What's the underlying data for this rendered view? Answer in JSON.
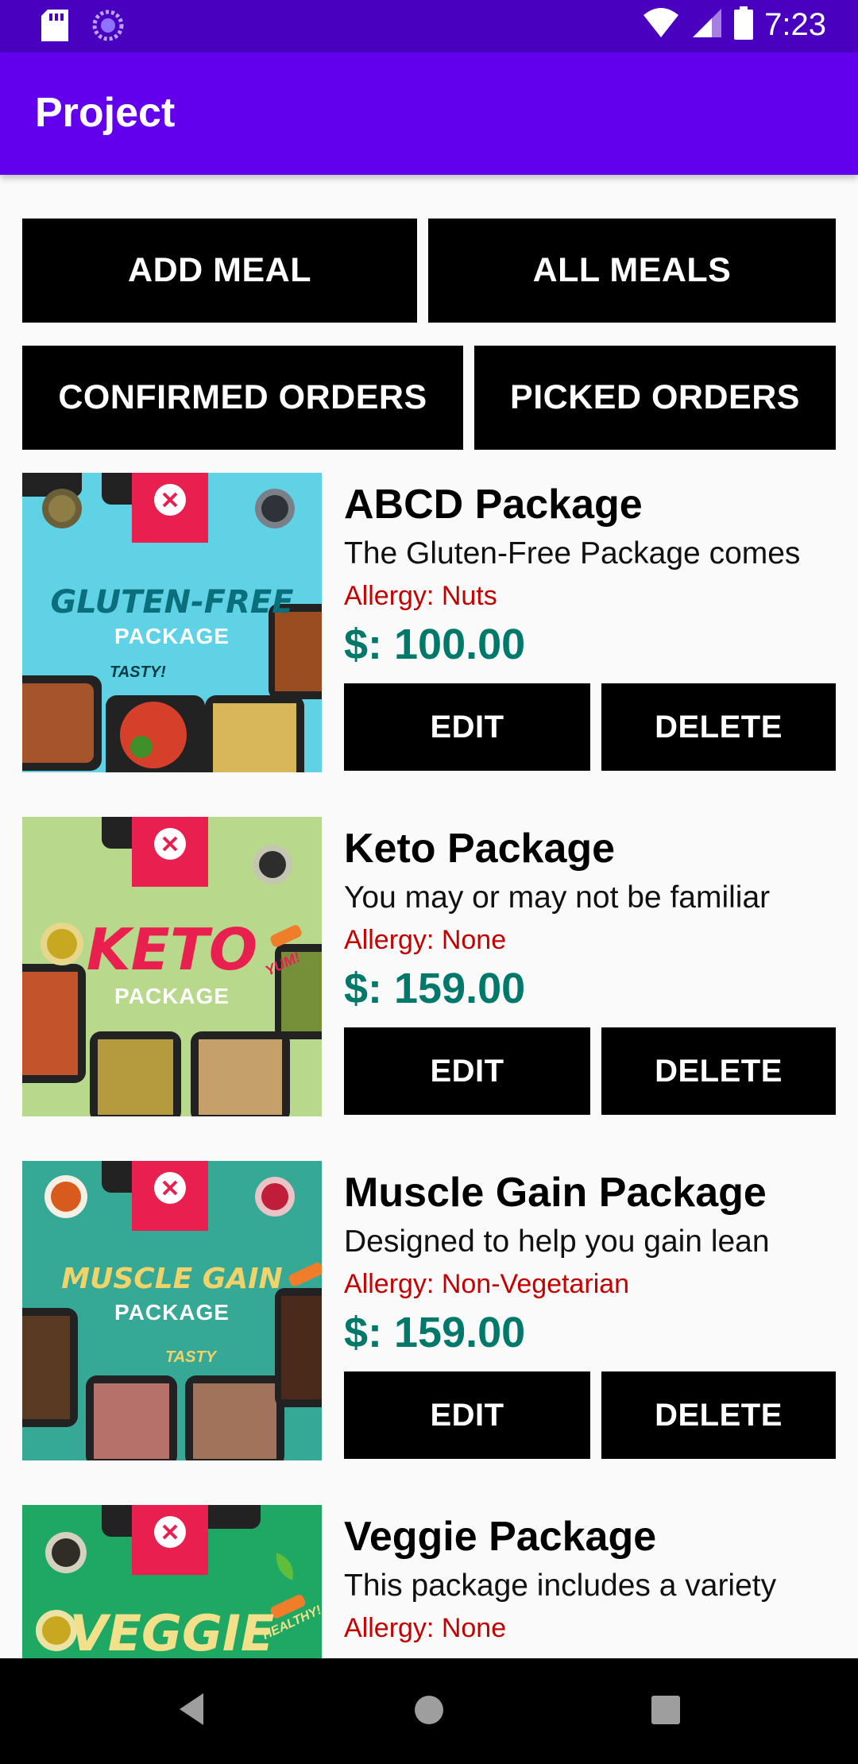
{
  "status_bar": {
    "time": "7:23",
    "left_icons": [
      "sd-card-icon",
      "sync-icon"
    ],
    "right_icons": [
      "wifi-icon",
      "signal-icon",
      "battery-icon"
    ]
  },
  "app_bar": {
    "title": "Project"
  },
  "actions": {
    "add_meal": "ADD MEAL",
    "all_meals": "ALL MEALS",
    "confirmed_orders": "CONFIRMED ORDERS",
    "picked_orders": "PICKED ORDERS"
  },
  "meals": [
    {
      "title": "ABCD Package",
      "description": "The Gluten-Free Package comes",
      "allergy": "Allergy: Nuts",
      "price": "$: 100.00",
      "edit": "EDIT",
      "delete": "DELETE",
      "image_headline": "GLUTEN-FREE",
      "image_sub": "PACKAGE",
      "image_tag": "TASTY!",
      "image_bg": "#5fd2e6",
      "headline_color": "#0a6f7a"
    },
    {
      "title": "Keto Package",
      "description": "You may or may not be familiar",
      "allergy": "Allergy: None",
      "price": "$: 159.00",
      "edit": "EDIT",
      "delete": "DELETE",
      "image_headline": "KETO",
      "image_sub": "PACKAGE",
      "image_tag": "YUM!",
      "image_bg": "#b8d88c",
      "headline_color": "#e9204f"
    },
    {
      "title": "Muscle Gain Package",
      "description": "Designed to help you gain lean",
      "allergy": "Allergy: Non-Vegetarian",
      "price": "$: 159.00",
      "edit": "EDIT",
      "delete": "DELETE",
      "image_headline": "MUSCLE GAIN",
      "image_sub": "PACKAGE",
      "image_tag": "TASTY",
      "image_bg": "#36a896",
      "headline_color": "#f0d36a"
    },
    {
      "title": "Veggie Package",
      "description": "This package includes a variety",
      "allergy": "Allergy: None",
      "image_headline": "VEGGIE",
      "image_tag": "HEALTHY!",
      "image_bg": "#1fa864",
      "headline_color": "#f2e08a"
    }
  ],
  "nav_bar": {
    "icons": [
      "back-icon",
      "home-icon",
      "recents-icon"
    ]
  }
}
